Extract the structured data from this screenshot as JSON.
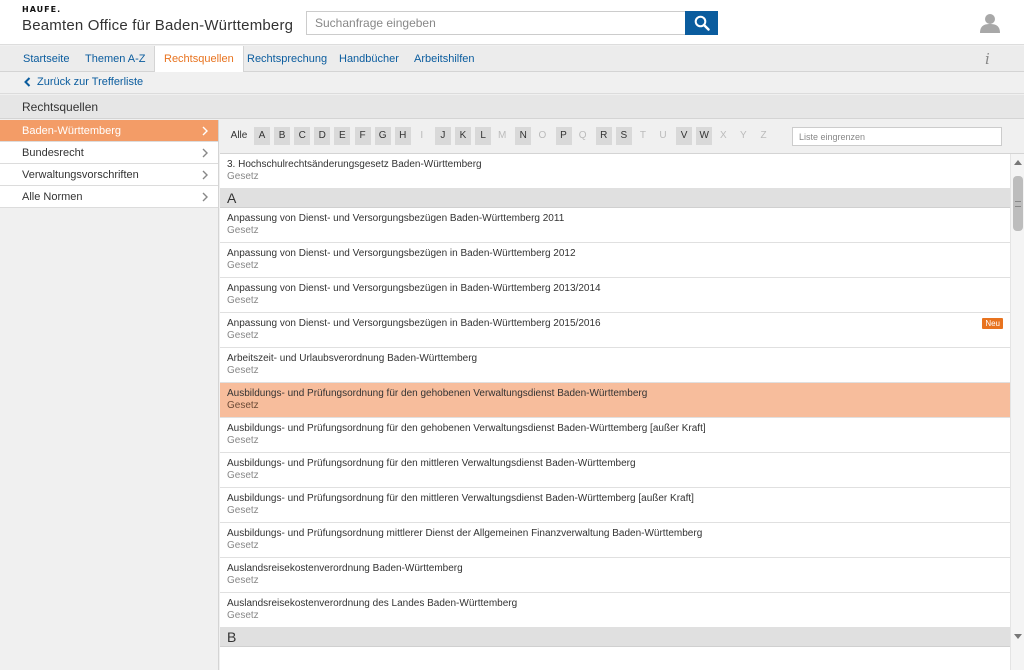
{
  "header": {
    "logo": "HAUFE.",
    "app_title": "Beamten Office für Baden-Württemberg",
    "search_placeholder": "Suchanfrage eingeben",
    "search_icon": "search-icon",
    "user_icon": "user-icon",
    "accent_color": "#0a5c9e"
  },
  "nav": {
    "tabs": [
      {
        "label": "Startseite",
        "active": false
      },
      {
        "label": "Themen A-Z",
        "active": false
      },
      {
        "label": "Rechtsquellen",
        "active": true
      },
      {
        "label": "Rechtsprechung",
        "active": false
      },
      {
        "label": "Handbücher",
        "active": false
      },
      {
        "label": "Arbeitshilfen",
        "active": false
      }
    ],
    "info_label": "i",
    "active_color": "#e8731f"
  },
  "back": {
    "label": "Zurück zur Trefferliste"
  },
  "section": {
    "title": "Rechtsquellen"
  },
  "sidebar": {
    "items": [
      {
        "label": "Baden-Württemberg",
        "active": true
      },
      {
        "label": "Bundesrecht",
        "active": false
      },
      {
        "label": "Verwaltungsvorschriften",
        "active": false
      },
      {
        "label": "Alle Normen",
        "active": false
      }
    ],
    "active_color": "#f39c67"
  },
  "alphabet": {
    "all_label": "Alle",
    "letters": [
      {
        "l": "A",
        "on": true
      },
      {
        "l": "B",
        "on": true
      },
      {
        "l": "C",
        "on": true
      },
      {
        "l": "D",
        "on": true
      },
      {
        "l": "E",
        "on": true
      },
      {
        "l": "F",
        "on": true
      },
      {
        "l": "G",
        "on": true
      },
      {
        "l": "H",
        "on": true
      },
      {
        "l": "I",
        "on": false
      },
      {
        "l": "J",
        "on": true
      },
      {
        "l": "K",
        "on": true
      },
      {
        "l": "L",
        "on": true
      },
      {
        "l": "M",
        "on": false
      },
      {
        "l": "N",
        "on": true
      },
      {
        "l": "O",
        "on": false
      },
      {
        "l": "P",
        "on": true
      },
      {
        "l": "Q",
        "on": false
      },
      {
        "l": "R",
        "on": true
      },
      {
        "l": "S",
        "on": true
      },
      {
        "l": "T",
        "on": false
      },
      {
        "l": "U",
        "on": false
      },
      {
        "l": "V",
        "on": true
      },
      {
        "l": "W",
        "on": true
      },
      {
        "l": "X",
        "on": false
      },
      {
        "l": "Y",
        "on": false
      },
      {
        "l": "Z",
        "on": false
      }
    ],
    "filter_placeholder": "Liste eingrenzen"
  },
  "list": [
    {
      "kind": "item",
      "title": "3. Hochschulrechtsänderungsgesetz Baden-Württemberg",
      "type": "Gesetz"
    },
    {
      "kind": "group",
      "title": "A"
    },
    {
      "kind": "item",
      "title": "Anpassung von Dienst- und Versorgungsbezügen Baden-Württemberg 2011",
      "type": "Gesetz"
    },
    {
      "kind": "item",
      "title": "Anpassung von Dienst- und Versorgungsbezügen in Baden-Württemberg 2012",
      "type": "Gesetz"
    },
    {
      "kind": "item",
      "title": "Anpassung von Dienst- und Versorgungsbezügen in Baden-Württemberg 2013/2014",
      "type": "Gesetz"
    },
    {
      "kind": "item",
      "title": "Anpassung von Dienst- und Versorgungsbezügen in Baden-Württemberg 2015/2016",
      "type": "Gesetz",
      "badge": "Neu"
    },
    {
      "kind": "item",
      "title": "Arbeitszeit- und Urlaubsverordnung Baden-Württemberg",
      "type": "Gesetz"
    },
    {
      "kind": "item",
      "title": "Ausbildungs- und Prüfungsordnung für den gehobenen Verwaltungsdienst Baden-Württemberg",
      "type": "Gesetz",
      "highlight": true
    },
    {
      "kind": "item",
      "title": "Ausbildungs- und Prüfungsordnung für den gehobenen Verwaltungsdienst Baden-Württemberg [außer Kraft]",
      "type": "Gesetz"
    },
    {
      "kind": "item",
      "title": "Ausbildungs- und Prüfungsordnung für den mittleren Verwaltungsdienst Baden-Württemberg",
      "type": "Gesetz"
    },
    {
      "kind": "item",
      "title": "Ausbildungs- und Prüfungsordnung für den mittleren Verwaltungsdienst Baden-Württemberg [außer Kraft]",
      "type": "Gesetz"
    },
    {
      "kind": "item",
      "title": "Ausbildungs- und Prüfungsordnung mittlerer Dienst der Allgemeinen Finanzverwaltung Baden-Württemberg",
      "type": "Gesetz"
    },
    {
      "kind": "item",
      "title": "Auslandsreisekostenverordnung Baden-Württemberg",
      "type": "Gesetz"
    },
    {
      "kind": "item",
      "title": "Auslandsreisekostenverordnung des Landes Baden-Württemberg",
      "type": "Gesetz"
    },
    {
      "kind": "group",
      "title": "B"
    }
  ]
}
